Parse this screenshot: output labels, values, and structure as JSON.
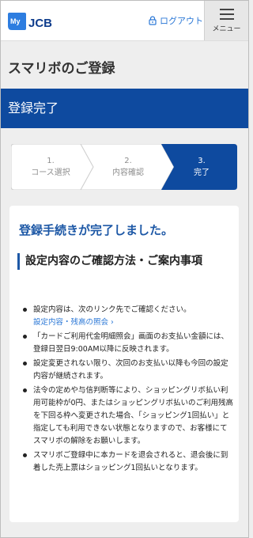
{
  "header": {
    "logo_my": "My",
    "logo_brand": "JCB",
    "logout_label": "ログアウト",
    "menu_label": "メニュー"
  },
  "page_title": "スマリボのご登録",
  "band_title": "登録完了",
  "stepper": {
    "active_color": "#0e4a9f",
    "steps": [
      {
        "num": "1.",
        "label": "コース選択"
      },
      {
        "num": "2.",
        "label": "内容確認"
      },
      {
        "num": "3.",
        "label": "完了"
      }
    ]
  },
  "content": {
    "complete_message": "登録手続きが完了しました。",
    "section_heading": "設定内容のご確認方法・ご案内事項",
    "items": [
      {
        "text": "設定内容は、次のリンク先でご確認ください。",
        "link": "設定内容・残高の照会"
      },
      {
        "text": "「カードご利用代金明細照会」画面のお支払い金額には、登録日翌日9:00AM以降に反映されます。"
      },
      {
        "text": "設定変更されない限り、次回のお支払い以降も今回の設定内容が継続されます。"
      },
      {
        "text": "法令の定めや与信判断等により、ショッピングリボ払い利用可能枠が0円、またはショッピングリボ払いのご利用残高を下回る枠へ変更された場合、「ショッピング1回払い」と指定しても利用できない状態となりますので、お客様にてスマリボの解除をお願いします。"
      },
      {
        "text": "スマリボご登録中に本カードを退会されると、退会後に到着した売上票はショッピング1回払いとなります。"
      }
    ]
  }
}
